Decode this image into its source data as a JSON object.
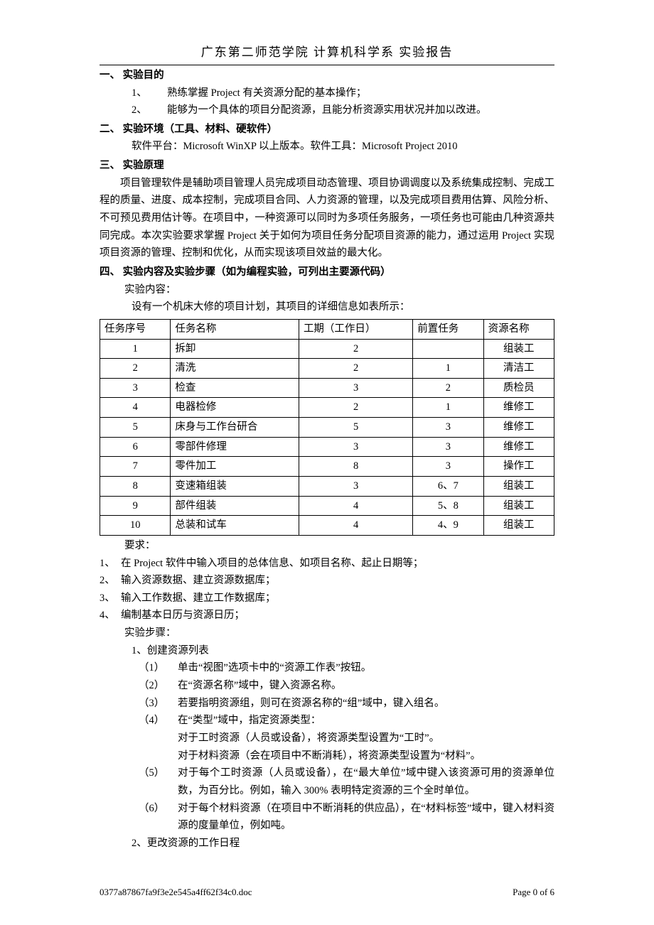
{
  "header": "广东第二师范学院  计算机科学系  实验报告",
  "sec1": {
    "head": "一、 实验目的",
    "items": [
      {
        "n": "1、",
        "t": "熟练掌握 Project 有关资源分配的基本操作；"
      },
      {
        "n": "2、",
        "t": "能够为一个具体的项目分配资源，且能分析资源实用状况并加以改进。"
      }
    ]
  },
  "sec2": {
    "head": "二、 实验环境（工具、材料、硬软件）",
    "text": "软件平台：Microsoft WinXP 以上版本。软件工具：Microsoft Project 2010"
  },
  "sec3": {
    "head": "三、 实验原理",
    "text": "项目管理软件是辅助项目管理人员完成项目动态管理、项目协调调度以及系统集成控制、完成工程的质量、进度、成本控制，完成项目合同、人力资源的管理，以及完成项目费用估算、风险分析、不可预见费用估计等。在项目中，一种资源可以同时为多项任务服务，一项任务也可能由几种资源共同完成。本次实验要求掌握 Project 关于如何为项目任务分配项目资源的能力，通过运用 Project 实现项目资源的管理、控制和优化，从而实现该项目效益的最大化。"
  },
  "sec4": {
    "head": "四、 实验内容及实验步骤（如为编程实验，可列出主要源代码）",
    "content_label": "实验内容：",
    "project_intro": "设有一个机床大修的项目计划，其项目的详细信息如表所示：",
    "table": {
      "headers": [
        "任务序号",
        "任务名称",
        "工期（工作日）",
        "前置任务",
        "资源名称"
      ],
      "rows": [
        [
          "1",
          "拆卸",
          "2",
          "",
          "组装工"
        ],
        [
          "2",
          "清洗",
          "2",
          "1",
          "清洁工"
        ],
        [
          "3",
          "检查",
          "3",
          "2",
          "质检员"
        ],
        [
          "4",
          "电器检修",
          "2",
          "1",
          "维修工"
        ],
        [
          "5",
          "床身与工作台研合",
          "5",
          "3",
          "维修工"
        ],
        [
          "6",
          "零部件修理",
          "3",
          "3",
          "维修工"
        ],
        [
          "7",
          "零件加工",
          "8",
          "3",
          "操作工"
        ],
        [
          "8",
          "变速箱组装",
          "3",
          "6、7",
          "组装工"
        ],
        [
          "9",
          "部件组装",
          "4",
          "5、8",
          "组装工"
        ],
        [
          "10",
          "总装和试车",
          "4",
          "4、9",
          "组装工"
        ]
      ]
    },
    "req_label": "要求：",
    "reqs": [
      {
        "n": "1、",
        "t": "在 Project 软件中输入项目的总体信息、如项目名称、起止日期等；"
      },
      {
        "n": "2、",
        "t": "输入资源数据、建立资源数据库；"
      },
      {
        "n": "3、",
        "t": "输入工作数据、建立工作数据库；"
      },
      {
        "n": "4、",
        "t": "编制基本日历与资源日历；"
      }
    ],
    "steps_label": "实验步骤：",
    "step1": {
      "title": "1、创建资源列表",
      "subs": [
        {
          "n": "（1）",
          "t": "单击“视图”选项卡中的“资源工作表”按钮。"
        },
        {
          "n": "（2）",
          "t": "在“资源名称”域中，键入资源名称。"
        },
        {
          "n": "（3）",
          "t": "若要指明资源组，则可在资源名称的“组”域中，键入组名。"
        },
        {
          "n": "（4）",
          "t": "在“类型”域中，指定资源类型："
        }
      ],
      "sub4a": "对于工时资源（人员或设备），将资源类型设置为“工时”。",
      "sub4b": "对于材料资源（会在项目中不断消耗），将资源类型设置为“材料”。",
      "sub5": {
        "n": "（5）",
        "t": "对于每个工时资源（人员或设备），在“最大单位”域中键入该资源可用的资源单位数，为百分比。例如，输入 300% 表明特定资源的三个全时单位。"
      },
      "sub6": {
        "n": "（6）",
        "t": "对于每个材料资源（在项目中不断消耗的供应品），在“材料标签”域中，键入材料资源的度量单位，例如吨。"
      }
    },
    "step2": "2、更改资源的工作日程"
  },
  "footer": {
    "left": "0377a87867fa9f3e2e545a4ff62f34c0.doc",
    "right": "Page  0  of 6"
  }
}
